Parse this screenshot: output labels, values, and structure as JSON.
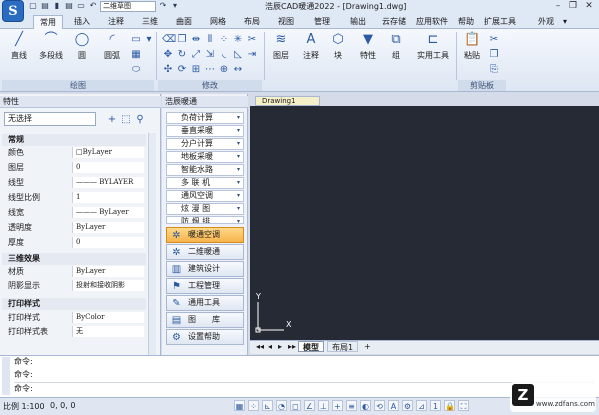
{
  "app": {
    "title": "浩辰CAD暖通2022 - [Drawing1.dwg]",
    "logo_glyph": "S",
    "workspace": "二维草图"
  },
  "title_buttons": {
    "minimize": "–",
    "restore": "❐",
    "close": "✕"
  },
  "quick_access": [
    "▢",
    "▤",
    "▮",
    "▤",
    "▭",
    "↶",
    "↷",
    "▾"
  ],
  "tabs": [
    "常用",
    "插入",
    "注释",
    "三维",
    "曲面",
    "网格",
    "布局",
    "视图",
    "管理",
    "输出",
    "云存储",
    "应用软件",
    "帮助",
    "扩展工具",
    "外观",
    "▾"
  ],
  "ribbon": {
    "draw_buttons": [
      "直线",
      "多段线",
      "圆",
      "圆弧"
    ],
    "draw_group": "绘图",
    "modify_group": "修改",
    "layer": "图层",
    "annotate": "注释",
    "block": "块",
    "properties": "特性",
    "group": "组",
    "utilities": "实用工具",
    "paste": "粘贴",
    "clipboard_group": "剪贴板"
  },
  "props": {
    "header": "特性",
    "selection": "无选择",
    "sections": {
      "general": "常规",
      "three_d": "三维效果",
      "plot": "打印样式"
    },
    "general_rows": [
      {
        "k": "颜色",
        "v": "□ByLayer"
      },
      {
        "k": "图层",
        "v": "0"
      },
      {
        "k": "线型",
        "v": "——— BYLAYER"
      },
      {
        "k": "线型比例",
        "v": "1"
      },
      {
        "k": "线宽",
        "v": "——— ByLayer"
      },
      {
        "k": "透明度",
        "v": "ByLayer"
      },
      {
        "k": "厚度",
        "v": "0"
      }
    ],
    "three_d_rows": [
      {
        "k": "材质",
        "v": "ByLayer"
      },
      {
        "k": "阴影显示",
        "v": "投射和接收阴影"
      }
    ],
    "plot_rows": [
      {
        "k": "打印样式",
        "v": "ByColor"
      },
      {
        "k": "打印样式表",
        "v": "无"
      }
    ]
  },
  "hvac": {
    "header": "浩辰暖通",
    "items": [
      "负荷计算",
      "垂直采暖",
      "分户计算",
      "地板采暖",
      "智能水路",
      "多 联 机",
      "通风空调",
      "炫 漫 图",
      "防 烟 排"
    ],
    "big_items": [
      {
        "label": "暖通空调",
        "icon": "fan-icon",
        "selected": true
      },
      {
        "label": "二维暖通",
        "icon": "fan-icon",
        "selected": false
      },
      {
        "label": "建筑设计",
        "icon": "building-icon",
        "selected": false
      },
      {
        "label": "工程管理",
        "icon": "project-icon",
        "selected": false
      },
      {
        "label": "通用工具",
        "icon": "tools-icon",
        "selected": false
      },
      {
        "label": "图　　库",
        "icon": "library-icon",
        "selected": false
      },
      {
        "label": "设置帮助",
        "icon": "help-icon",
        "selected": false
      }
    ]
  },
  "drawing": {
    "tab": "Drawing1",
    "axis_y": "Y",
    "axis_x": "X",
    "model_tab": "模型",
    "layout_tab": "布局1",
    "add_tab": "+",
    "nav": [
      "◂◂",
      "◂",
      "▸",
      "▸▸"
    ]
  },
  "command": {
    "lines": [
      "命令:",
      "命令:",
      "命令:"
    ]
  },
  "status": {
    "scale": "比例 1:100",
    "coords": "0, 0, 0"
  },
  "watermark": {
    "logo": "Z",
    "text": "www.zdfans.com"
  },
  "colors": {
    "canvas": "#252a35",
    "accent": "#2a6cc0",
    "selected": "#f7b34a"
  }
}
